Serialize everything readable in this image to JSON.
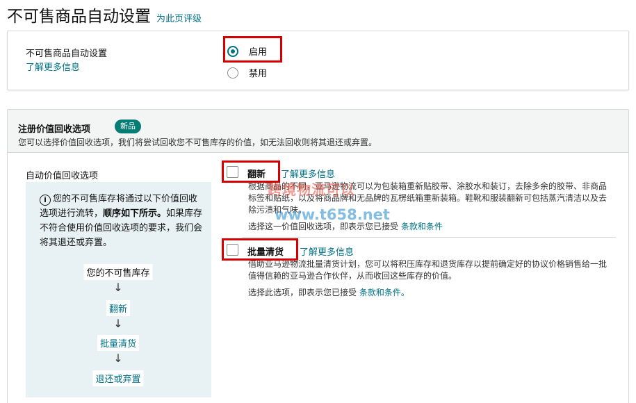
{
  "header": {
    "title": "不可售商品自动设置",
    "rate_link": "为此页评级"
  },
  "setting_card": {
    "label": "不可售商品自动设置",
    "learn_more": "了解更多信息",
    "options": [
      {
        "label": "启用",
        "selected": true
      },
      {
        "label": "禁用",
        "selected": false
      }
    ]
  },
  "recovery_card": {
    "title": "注册价值回收选项",
    "badge": "新品",
    "subtitle": "您可以选择价值回收选项，我们将尝试回收您不可售库存的价值，如无法回收则将其退还或弃置。",
    "auto_label": "自动价值回收选项",
    "info": {
      "text_before": "您的不可售库存将通过以下价值回收选项进行流转，",
      "text_bold": "顺序如下所示。",
      "text_after": "如果库存不符合使用价值回收选项的要求，我们会将其退还或弃置。"
    },
    "flow": [
      "您的不可售库存",
      "翻新",
      "批量清货",
      "退还或弃置"
    ],
    "arrow_glyph": "↓",
    "options": [
      {
        "title": "翻新",
        "learn_more": "了解更多信息",
        "checked": false,
        "description": "根据商品的不同，亚马逊物流可以为包装箱重新贴胶带、涂胶水和装订，去除多余的胶带、非商品标签和贴纸，以及将商品牌和无品牌的瓦楞纸箱重新装箱。鞋靴和服装翻新可包括蒸汽清洁以及去除污渍和气味。",
        "accept_prefix": "选择这一价值回收选项，即表示您已接受",
        "accept_link": "条款和条件"
      },
      {
        "title": "批量清货",
        "learn_more": "了解更多信息",
        "checked": false,
        "description": "借助亚马逊物流批量清货计划，您可以将积压库存和退货库存以提前确定好的协议价格销售给一批值得信赖的亚马逊合作伙伴，从而收回这些库存的价值。",
        "accept_prefix": "选择此选项，即表示您已接受",
        "accept_link": "条款和条件。"
      }
    ]
  },
  "watermark": {
    "top": "跨境物流可以",
    "bottom": "www.t658.net"
  },
  "colors": {
    "link": "#007185",
    "badge": "#067d74",
    "highlight": "#d60000",
    "info_panel": "#e8f2f5"
  }
}
